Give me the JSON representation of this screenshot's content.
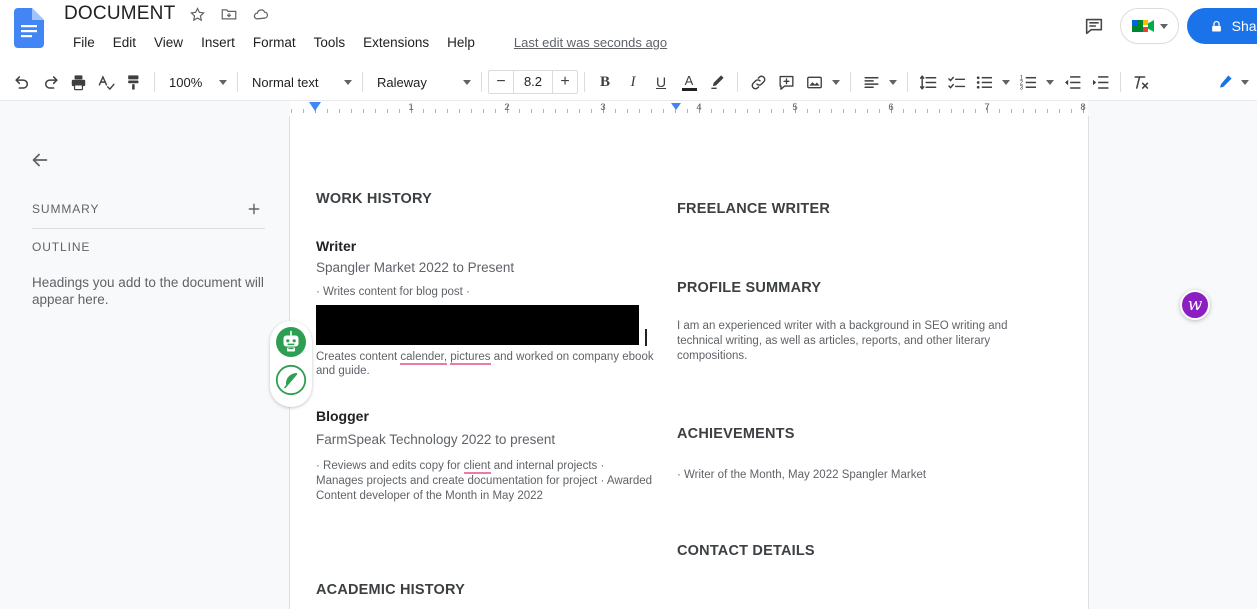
{
  "header": {
    "doc_title": "DOCUMENT",
    "title_icons": [
      "star-icon",
      "move-to-folder-icon",
      "cloud-saved-icon"
    ],
    "menus": [
      "File",
      "Edit",
      "View",
      "Insert",
      "Format",
      "Tools",
      "Extensions",
      "Help"
    ],
    "last_edit": "Last edit was seconds ago",
    "comment_icon": "comment-icon",
    "meet_icon": "google-meet-icon",
    "share_label": "Share",
    "share_lock_icon": "lock-icon",
    "accent_blue": "#1a73e8"
  },
  "toolbar": {
    "undo_icon": "undo-icon",
    "redo_icon": "redo-icon",
    "print_icon": "print-icon",
    "spellcheck_icon": "spellcheck-icon",
    "paint_format_icon": "paint-format-icon",
    "zoom_value": "100%",
    "paragraph_style": "Normal text",
    "font_family": "Raleway",
    "font_size": "8.2",
    "decrease_font_label": "−",
    "increase_font_label": "+",
    "bold_label": "B",
    "italic_label": "I",
    "underline_label": "U",
    "text_color_label": "A",
    "highlight_icon": "highlight-pen-icon",
    "link_icon": "insert-link-icon",
    "comment_icon": "add-comment-icon",
    "image_icon": "insert-image-icon",
    "align_icon": "align-left-icon",
    "line_spacing_icon": "line-spacing-icon",
    "checklist_icon": "checklist-icon",
    "bulleted_list_icon": "bulleted-list-icon",
    "numbered_list_icon": "numbered-list-icon",
    "decrease_indent_icon": "decrease-indent-icon",
    "increase_indent_icon": "increase-indent-icon",
    "clear_formatting_icon": "clear-formatting-icon",
    "editing_mode_icon": "pencil-edit-icon"
  },
  "ruler": {
    "numbers": [
      "1",
      "2",
      "3",
      "4",
      "5",
      "6",
      "7",
      "8"
    ],
    "left_indent_marker": "left-indent-marker",
    "right_indent_marker": "right-indent-marker"
  },
  "sidebar": {
    "back_icon": "back-arrow-icon",
    "summary_label": "SUMMARY",
    "add_summary_icon": "plus-icon",
    "outline_label": "OUTLINE",
    "outline_empty_note": "Headings you add to the document will appear here."
  },
  "addons": {
    "bot_icon": "robot-assistant-icon",
    "feather_icon": "feather-quill-icon",
    "wordtune_badge": "w",
    "addon_green": "#2e9e53",
    "wordtune_purple": "#8b1fc4"
  },
  "document": {
    "left_column": {
      "section_title": "WORK HISTORY",
      "jobs": [
        {
          "title": "Writer",
          "company": "Spangler Market 2022 to Present",
          "bullet_line": "· Writes content for blog post ·",
          "redacted": true,
          "description_pre": "Creates content ",
          "misspelled_1": "calender,",
          "description_mid": " ",
          "misspelled_2": "pictures",
          "description_post": " and worked on company ebook and guide."
        },
        {
          "title": "Blogger",
          "company": "FarmSpeak Technology 2022 to present",
          "description_pre": "· Reviews and edits copy for ",
          "misspelled_1": "client",
          "description_post": " and internal projects · Manages projects and create documentation for project · Awarded Content developer of the Month in May 2022"
        }
      ],
      "next_section_title": "ACADEMIC HISTORY"
    },
    "right_column": {
      "role_title": "FREELANCE WRITER",
      "profile_heading": "PROFILE SUMMARY",
      "profile_text": "I am an experienced writer with a background in SEO writing and technical writing, as well as articles, reports, and other literary compositions.",
      "achievements_heading": "ACHIEVEMENTS",
      "achievements_items": [
        "· Writer of the Month, May 2022 Spangler Market"
      ],
      "contact_heading": "CONTACT DETAILS"
    }
  }
}
